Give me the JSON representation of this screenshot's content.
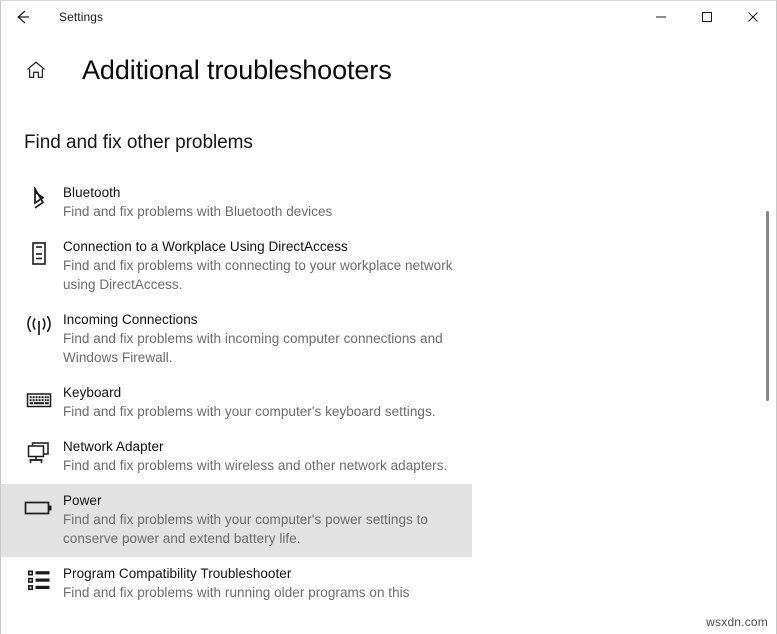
{
  "titlebar": {
    "back_label": "back-arrow",
    "app_title": "Settings",
    "minimize_label": "—",
    "maximize_label": "□",
    "close_label": "✕"
  },
  "header": {
    "home_icon": "home-icon",
    "page_title": "Additional troubleshooters"
  },
  "section": {
    "title": "Find and fix other problems"
  },
  "items": [
    {
      "icon": "bluetooth-icon",
      "title": "Bluetooth",
      "desc": "Find and fix problems with Bluetooth devices",
      "selected": false
    },
    {
      "icon": "workplace-device-icon",
      "title": "Connection to a Workplace Using DirectAccess",
      "desc": "Find and fix problems with connecting to your workplace network using DirectAccess.",
      "selected": false
    },
    {
      "icon": "broadcast-antenna-icon",
      "title": "Incoming Connections",
      "desc": "Find and fix problems with incoming computer connections and Windows Firewall.",
      "selected": false
    },
    {
      "icon": "keyboard-icon",
      "title": "Keyboard",
      "desc": "Find and fix problems with your computer's keyboard settings.",
      "selected": false
    },
    {
      "icon": "network-adapter-icon",
      "title": "Network Adapter",
      "desc": "Find and fix problems with wireless and other network adapters.",
      "selected": false
    },
    {
      "icon": "battery-power-icon",
      "title": "Power",
      "desc": "Find and fix problems with your computer's power settings to conserve power and extend battery life.",
      "selected": true
    },
    {
      "icon": "program-list-icon",
      "title": "Program Compatibility Troubleshooter",
      "desc": "Find and fix problems with running older programs on this",
      "selected": false
    }
  ],
  "scrollbar": {
    "thumb_label": "scroll-thumb"
  },
  "watermark": {
    "text": "wsxdn.com"
  },
  "colors": {
    "selected_row_bg": "#e2e2e2",
    "title_text": "#0c0c0c",
    "desc_text": "#6c6c6c",
    "scroll_thumb": "#898989"
  }
}
